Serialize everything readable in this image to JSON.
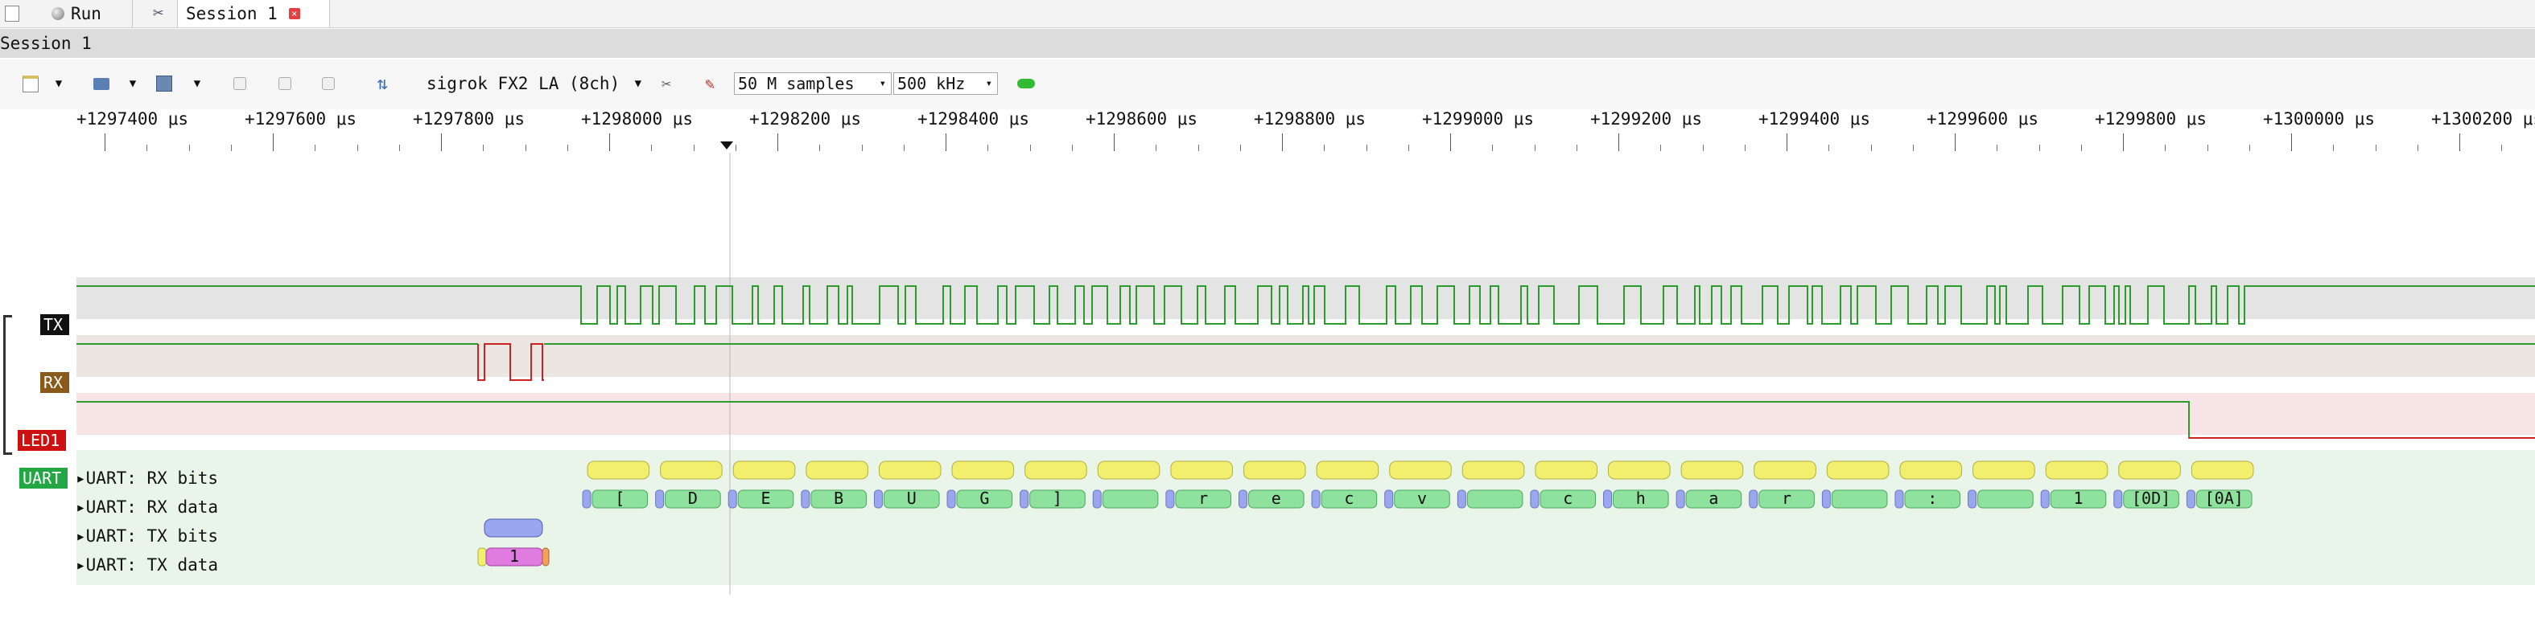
{
  "tabs": {
    "run_label": "Run",
    "session_label": "Session 1"
  },
  "session": {
    "title": "Session 1"
  },
  "toolbar": {
    "device": "sigrok FX2 LA (8ch)",
    "samples": "50 M samples",
    "samplerate": "500 kHz"
  },
  "ruler": {
    "unit": "μs",
    "ticks": [
      "+1297400",
      "+1297600",
      "+1297800",
      "+1298000",
      "+1298200",
      "+1298400",
      "+1298600",
      "+1298800",
      "+1299000",
      "+1299200",
      "+1299400",
      "+1299600",
      "+1299800",
      "+1300000",
      "+1300200"
    ]
  },
  "channels": {
    "tx": {
      "label": "TX",
      "color": "#111111"
    },
    "rx": {
      "label": "RX",
      "color": "#8a5a1a"
    },
    "led": {
      "label": "LED1",
      "color": "#cc1111"
    },
    "uart": {
      "label": "UART",
      "color": "#22a744"
    }
  },
  "decoder_rows": {
    "rx_bits": "UART: RX bits",
    "rx_data": "UART: RX data",
    "tx_bits": "UART: TX bits",
    "tx_data": "UART: TX data"
  },
  "rx_data_values": [
    "[",
    "D",
    "E",
    "B",
    "U",
    "G",
    "]",
    "",
    "r",
    "e",
    "c",
    "v",
    "",
    "c",
    "h",
    "a",
    "r",
    "",
    ":",
    "",
    "1",
    "[0D]",
    "[0A]"
  ],
  "tx_data_values": [
    "1"
  ],
  "colors": {
    "trace_high": "#2e9b2e",
    "trace_low": "#cc2222",
    "bits_fill": "#f2ef6e",
    "data_fill": "#8ee29e",
    "start_fill": "#9aa6ee",
    "tx_data_fill": "#e07be0",
    "stop_fill": "#f0a060"
  }
}
